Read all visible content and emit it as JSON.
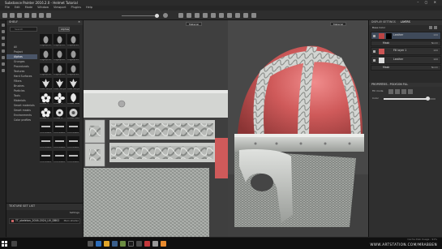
{
  "window": {
    "title": "Substance Painter 2016.2.0 - Helmet Tutorial",
    "controls": "–  ▢  ✕"
  },
  "menu": [
    "File",
    "Edit",
    "Mode",
    "Window",
    "Viewport",
    "Plugins",
    "Help"
  ],
  "shelf": {
    "title": "SHELF",
    "search_placeholder": "Search",
    "filter": "Alphas",
    "categories": [
      "All",
      "Project",
      "Alphas",
      "Grunges",
      "Procedurals",
      "Textures",
      "Hard Surfaces",
      "Filters",
      "Brushes",
      "Particles",
      "Tools",
      "Materials",
      "Smart materials",
      "Smart masks",
      "Environments",
      "Color profiles"
    ],
    "active_category": "Alphas",
    "items": [
      "Fingerprint",
      "Fingerprint",
      "Fingerprint",
      "Fingerprint",
      "Fingerprint",
      "Fingerprint",
      "Fingerprint",
      "Fingerprint",
      "Fingerprint",
      "Fleur de lys",
      "Fleur de lys",
      "Fleur de lys",
      "Flower 1",
      "Flower 2",
      "Flower Stamp",
      "Flower 3",
      "Flower 4",
      "Flower Pattern",
      "Font Blade",
      "Font Blade",
      "Font Blade",
      "Font Blade",
      "Font Blade",
      "Font Blade",
      "Font Blade",
      "Font Blade",
      "Font Blade"
    ]
  },
  "texture_set": {
    "title": "TEXTURE SET LIST",
    "settings_label": "Settings",
    "row_label": "TT_skeleton_2016-2024_UV_DB02",
    "shader": "Main shader"
  },
  "viewports": {
    "view2d_mode": "Material",
    "view3d_mode": "Material"
  },
  "right_panel": {
    "tabs": [
      "DISPLAY SETTINGS",
      "LAYERS"
    ],
    "active_tab": "LAYERS",
    "blend_label": "Base Color",
    "layers": [
      {
        "name": "Leather",
        "blend": "Norm",
        "opacity": "100"
      },
      {
        "name": "Mask",
        "blend": "Norm",
        "opacity": "100"
      },
      {
        "name": "Fill layer 1",
        "blend": "Norm",
        "opacity": "100"
      },
      {
        "name": "Leather",
        "blend": "Norm",
        "opacity": "100"
      },
      {
        "name": "Mask",
        "blend": "Norm",
        "opacity": "100"
      }
    ],
    "properties_title": "PROPERTIES - POLYGON FILL",
    "prop_fill_label": "Fill mode",
    "prop_color_label": "Color",
    "prop_value": 0.85
  },
  "status": {
    "text": "Cache Disk Usage : 91%"
  },
  "watermark": "WWW.ARTSTATION.COM/MRABBEN",
  "colors": {
    "accent": "#d9534f",
    "helmet_red": "#cf5a5a",
    "metal": "#c9cbc8",
    "bg": "#1a1a1a"
  }
}
